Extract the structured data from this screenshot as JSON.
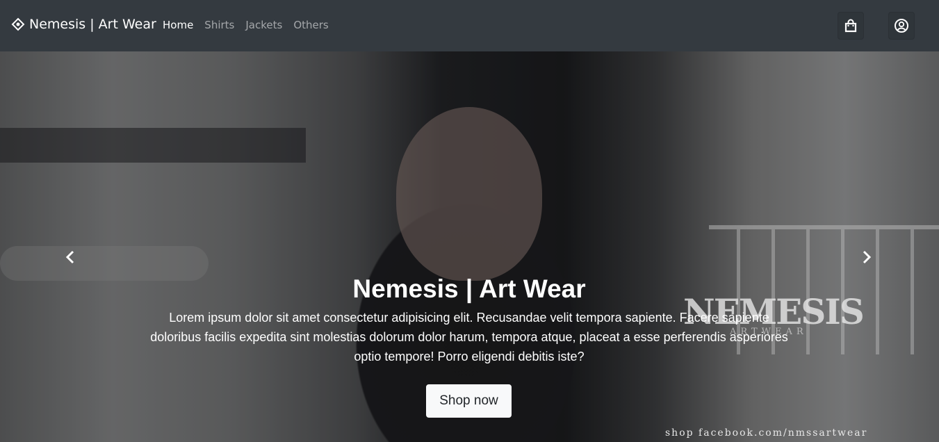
{
  "navbar": {
    "brand": "Nemesis | Art Wear",
    "links": [
      {
        "label": "Home",
        "active": true
      },
      {
        "label": "Shirts",
        "active": false
      },
      {
        "label": "Jackets",
        "active": false
      },
      {
        "label": "Others",
        "active": false
      }
    ],
    "icons": [
      "brand-diamond-icon",
      "shopping-bag-icon",
      "user-circle-icon"
    ]
  },
  "hero": {
    "title": "Nemesis | Art Wear",
    "text": "Lorem ipsum dolor sit amet consectetur adipisicing elit. Recusandae velit tempora sapiente. Facere sapiente doloribus facilis expedita sint molestias dolorum dolor harum, tempora atque, placeat a esse perferendis asperiores optio tempore! Porro eligendi debitis iste?",
    "cta": "Shop now",
    "watermark": "NEMESIS",
    "watermark_sub": "ARTWEAR",
    "footer_mark": "shop facebook.com/nmssartwear"
  },
  "colors": {
    "navbar_bg": "#343a40",
    "cta_bg": "#f8f9fa"
  }
}
